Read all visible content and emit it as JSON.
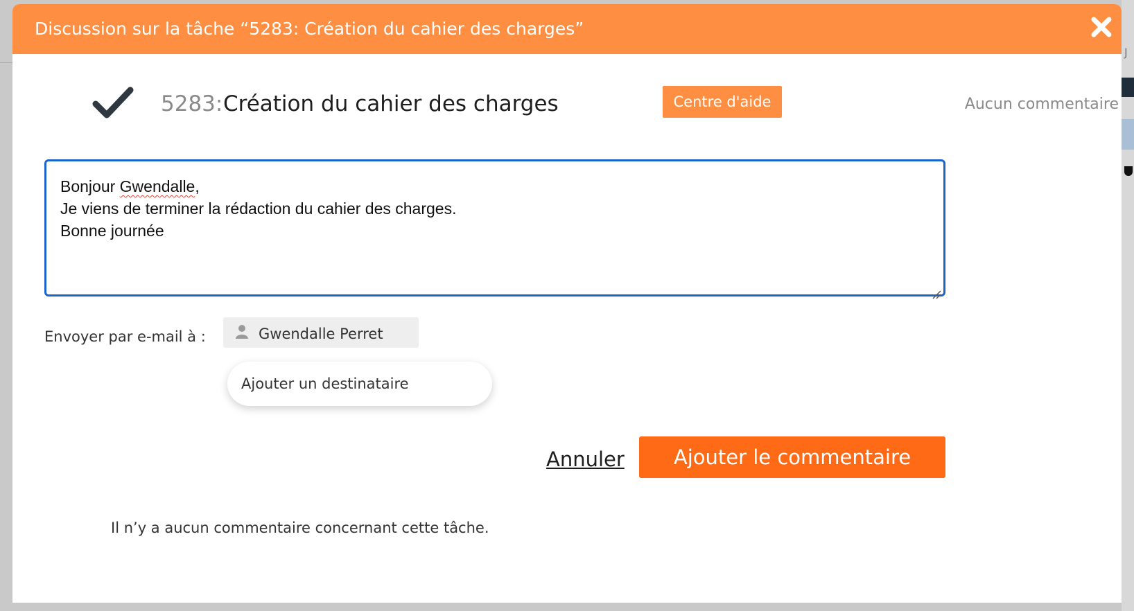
{
  "modal": {
    "title": "Discussion sur la tâche “5283: Création du cahier des charges”",
    "close_icon": "close-icon"
  },
  "task": {
    "status_icon": "checkmark-icon",
    "number": "5283:",
    "name": "Création du cahier des charges",
    "help_label": "Centre d'aide",
    "comment_count": "Aucun commentaire"
  },
  "comment": {
    "lines": {
      "greeting_prefix": "Bonjour ",
      "greeting_name": "Gwendalle",
      "greeting_suffix": ",",
      "line2": "Je viens de terminer la rédaction du cahier des charges.",
      "line3": "Bonne journée"
    }
  },
  "email": {
    "label": "Envoyer par e-mail à :",
    "recipients": [
      {
        "name": "Gwendalle Perret",
        "icon": "user-icon"
      }
    ],
    "add_label": "Ajouter un destinataire"
  },
  "actions": {
    "cancel_label": "Annuler",
    "submit_label": "Ajouter le commentaire"
  },
  "empty_message": "Il n’y a aucun commentaire concernant cette tâche.",
  "colors": {
    "header_orange": "#fe8e41",
    "button_orange": "#fe6a16",
    "focus_blue": "#1a63c8"
  }
}
